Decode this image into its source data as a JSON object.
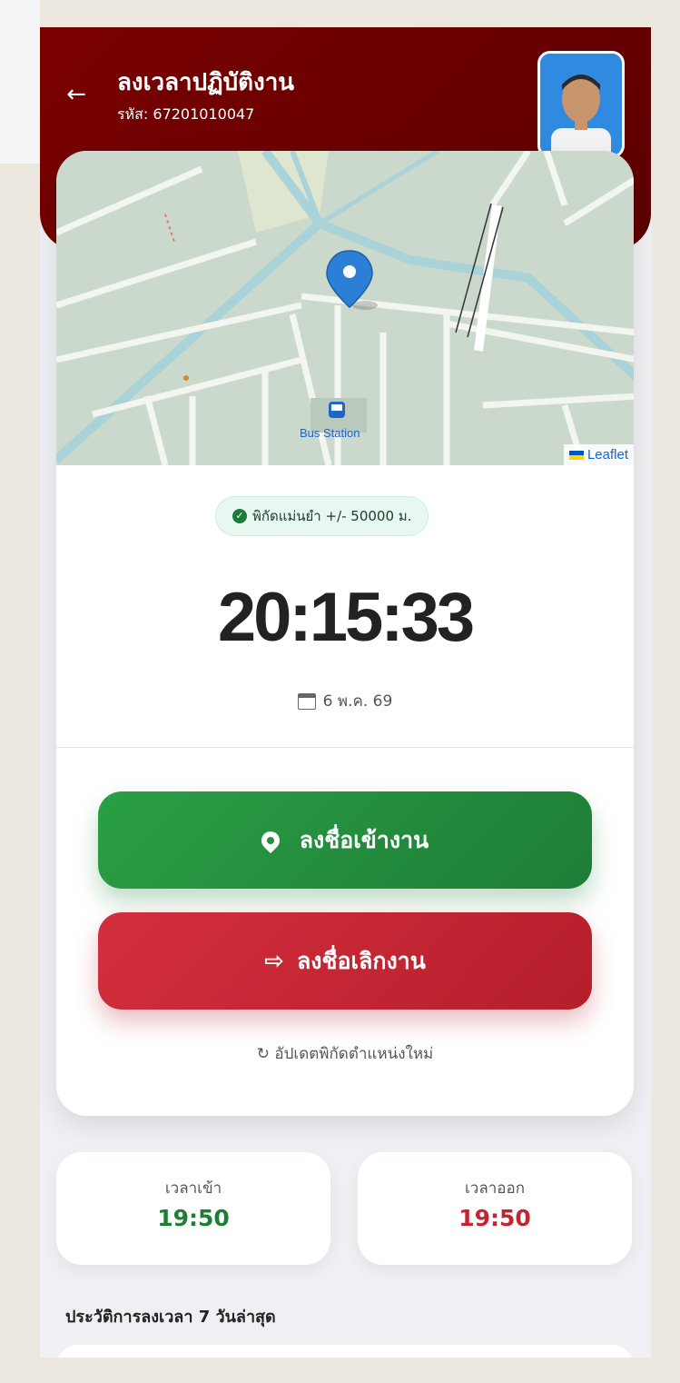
{
  "header": {
    "title": "ลงเวลาปฏิบัติงาน",
    "subtitle": "รหัส: 67201010047"
  },
  "map": {
    "poi_label": "Bus Station",
    "attribution": "Leaflet",
    "icons": [
      "map-marker-icon",
      "bus-icon"
    ]
  },
  "accuracy": {
    "text": "พิกัดแม่นยำ +/- 50000 ม."
  },
  "clock": {
    "time": "20:15:33",
    "date": "6 พ.ค. 69"
  },
  "actions": {
    "check_in_label": "ลงชื่อเข้างาน",
    "check_out_label": "ลงชื่อเลิกงาน",
    "refresh_label": "↻ อัปเดตพิกัดตำแหน่งใหม่"
  },
  "stats": {
    "in_label": "เวลาเข้า",
    "in_value": "19:50",
    "out_label": "เวลาออก",
    "out_value": "19:50"
  },
  "history": {
    "title": "ประวัติการลงเวลา 7 วันล่าสุด"
  },
  "colors": {
    "header": "#6b0000",
    "check_in": "#2a9f45",
    "check_out": "#c42333"
  }
}
